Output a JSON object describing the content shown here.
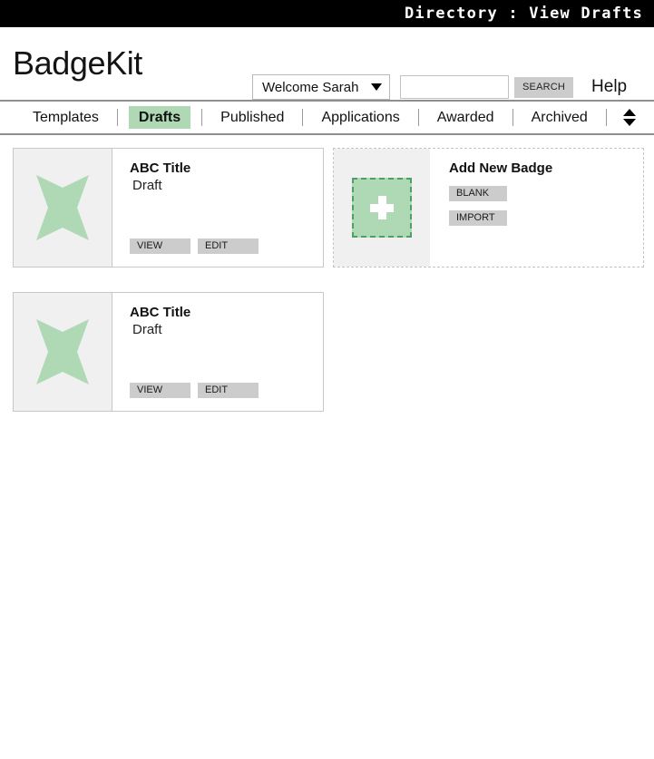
{
  "topbar": {
    "title": "Directory : View Drafts"
  },
  "header": {
    "brand": "BadgeKit",
    "user_menu_label": "Welcome Sarah",
    "search_value": "",
    "search_placeholder": "",
    "search_button_label": "SEARCH",
    "help_label": "Help"
  },
  "nav": {
    "items": [
      {
        "label": "Templates",
        "active": false
      },
      {
        "label": "Drafts",
        "active": true
      },
      {
        "label": "Published",
        "active": false
      },
      {
        "label": "Applications",
        "active": false
      },
      {
        "label": "Awarded",
        "active": false
      },
      {
        "label": "Archived",
        "active": false
      }
    ],
    "active_bg": "#aed9b4"
  },
  "badges": [
    {
      "title": "ABC Title",
      "status": "Draft",
      "view_label": "VIEW",
      "edit_label": "EDIT"
    },
    {
      "title": "ABC Title",
      "status": "Draft",
      "view_label": "VIEW",
      "edit_label": "EDIT"
    }
  ],
  "add_new": {
    "title": "Add New Badge",
    "blank_label": "BLANK",
    "import_label": "IMPORT"
  },
  "colors": {
    "accent_green": "#aed9b4",
    "accent_green_dark": "#4f9d6b",
    "button_grey": "#cccccc",
    "thumb_bg": "#f0f0f0"
  }
}
